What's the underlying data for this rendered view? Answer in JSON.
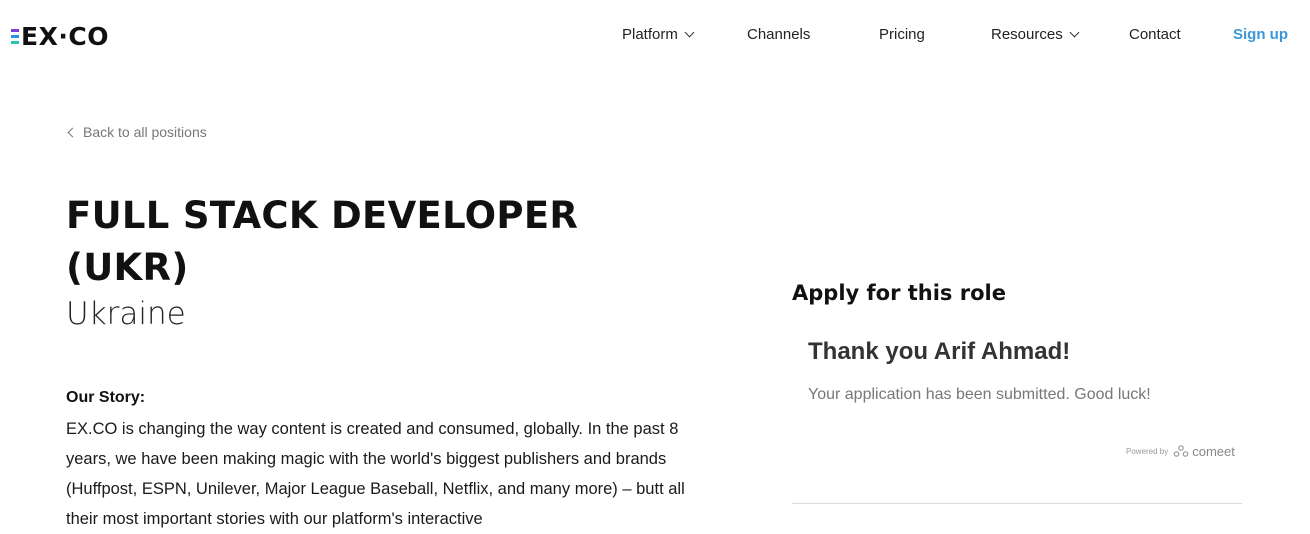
{
  "nav": {
    "logo": "EX·CO",
    "items": [
      {
        "label": "Platform",
        "has_dropdown": true
      },
      {
        "label": "Channels",
        "has_dropdown": false
      },
      {
        "label": "Pricing",
        "has_dropdown": false
      },
      {
        "label": "Resources",
        "has_dropdown": true
      },
      {
        "label": "Contact",
        "has_dropdown": false
      }
    ],
    "signup_label": "Sign up"
  },
  "back_link": "Back to all positions",
  "job": {
    "title": "FULL STACK DEVELOPER (UKR)",
    "location": "Ukraine"
  },
  "story": {
    "heading": "Our Story:",
    "text": "EX.CO is changing the way content is created and consumed, globally. In the past 8 years, we have been making magic with the world's biggest publishers and brands (Huffpost, ESPN, Unilever, Major League Baseball, Netflix, and many more) – butt all their most important stories with our platform's interactive"
  },
  "apply": {
    "heading": "Apply for this role",
    "thank_you": "Thank you Arif Ahmad!",
    "message": "Your application has been submitted. Good luck!",
    "powered_by": "Powered by",
    "powered_brand": "comeet"
  },
  "colors": {
    "accent_link": "#3a97d9",
    "logo_bar_1": "#7a3fd6",
    "logo_bar_2": "#2f8fe0",
    "logo_bar_3": "#20c6b6"
  },
  "icons": [
    "chevron-down-icon",
    "chevron-left-icon",
    "comeet-logo-icon"
  ]
}
